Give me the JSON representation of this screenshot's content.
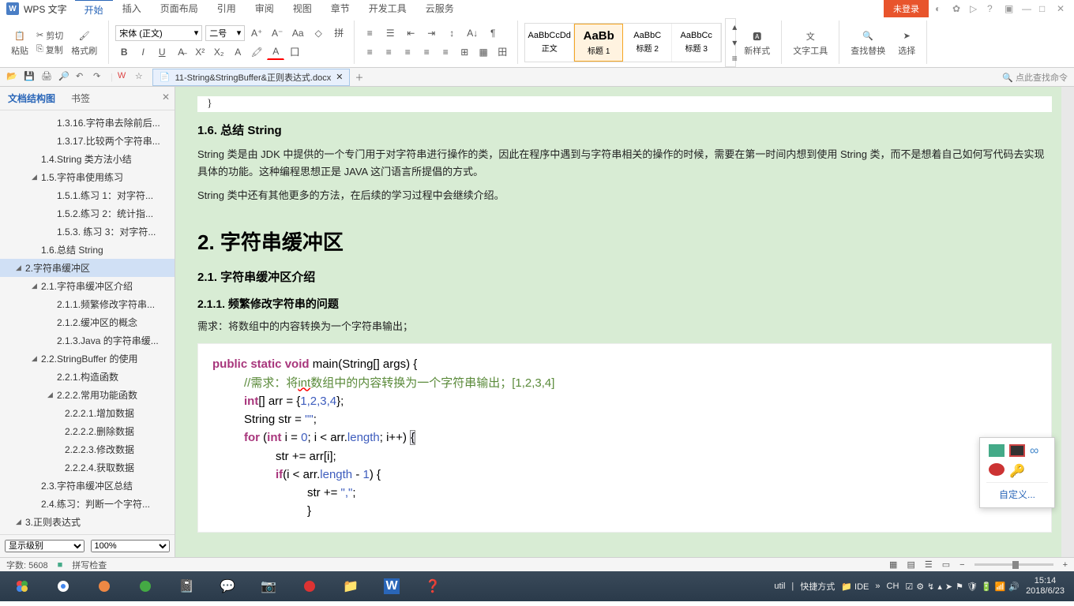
{
  "titlebar": {
    "app_prefix": "W",
    "app_name": "WPS 文字",
    "tabs": [
      "开始",
      "插入",
      "页面布局",
      "引用",
      "审阅",
      "视图",
      "章节",
      "开发工具",
      "云服务"
    ],
    "login_badge": "未登录"
  },
  "ribbon": {
    "paste": "粘贴",
    "cut": "剪切",
    "copy": "复制",
    "format_painter": "格式刷",
    "font_name": "宋体 (正文)",
    "font_size": "二号",
    "styles": [
      {
        "preview": "AaBbCcDd",
        "name": "正文"
      },
      {
        "preview": "AaBb",
        "name": "标题 1"
      },
      {
        "preview": "AaBbC",
        "name": "标题 2"
      },
      {
        "preview": "AaBbCc",
        "name": "标题 3"
      }
    ],
    "new_style": "新样式",
    "text_tools": "文字工具",
    "find_replace": "查找替换",
    "select": "选择"
  },
  "quick": {
    "doc_tab": "11-String&StringBuffer&正则表达式.docx",
    "search_hint": "点此查找命令"
  },
  "sidebar": {
    "tab1": "文档结构图",
    "tab2": "书签",
    "items": [
      {
        "l": 2,
        "t": "1.3.16.字符串去除前后..."
      },
      {
        "l": 2,
        "t": "1.3.17.比较两个字符串..."
      },
      {
        "l": 1,
        "t": "1.4.String 类方法小结"
      },
      {
        "l": 1,
        "t": "1.5.字符串使用练习",
        "exp": true
      },
      {
        "l": 2,
        "t": "1.5.1.练习 1：对字符..."
      },
      {
        "l": 2,
        "t": "1.5.2.练习 2：统计指..."
      },
      {
        "l": 2,
        "t": "1.5.3. 练习 3：对字符..."
      },
      {
        "l": 1,
        "t": "1.6.总结 String"
      },
      {
        "l": 0,
        "t": "2.字符串缓冲区",
        "sel": true,
        "exp": true
      },
      {
        "l": 1,
        "t": "2.1.字符串缓冲区介绍",
        "exp": true
      },
      {
        "l": 2,
        "t": "2.1.1.频繁修改字符串..."
      },
      {
        "l": 2,
        "t": "2.1.2.缓冲区的概念"
      },
      {
        "l": 2,
        "t": "2.1.3.Java 的字符串缓..."
      },
      {
        "l": 1,
        "t": "2.2.StringBuffer 的使用",
        "exp": true
      },
      {
        "l": 2,
        "t": "2.2.1.构造函数"
      },
      {
        "l": 2,
        "t": "2.2.2.常用功能函数",
        "exp": true
      },
      {
        "l": 3,
        "t": "2.2.2.1.增加数据"
      },
      {
        "l": 3,
        "t": "2.2.2.2.删除数据"
      },
      {
        "l": 3,
        "t": "2.2.2.3.修改数据"
      },
      {
        "l": 3,
        "t": "2.2.2.4.获取数据"
      },
      {
        "l": 1,
        "t": "2.3.字符串缓冲区总结"
      },
      {
        "l": 1,
        "t": "2.4.练习：判断一个字符..."
      },
      {
        "l": 0,
        "t": "3.正则表达式",
        "exp": true
      }
    ],
    "level_label": "显示级别",
    "zoom": "100%"
  },
  "document": {
    "h_1_6": "1.6. 总结 String",
    "p1": "String 类是由 JDK 中提供的一个专门用于对字符串进行操作的类，因此在程序中遇到与字符串相关的操作的时候，需要在第一时间内想到使用 String 类，而不是想着自己如何写代码去实现具体的功能。这种编程思想正是 JAVA 这门语言所提倡的方式。",
    "p2": "String 类中还有其他更多的方法，在后续的学习过程中会继续介绍。",
    "h_2": "2. 字符串缓冲区",
    "h_2_1": "2.1. 字符串缓冲区介绍",
    "h_2_1_1": "2.1.1. 频繁修改字符串的问题",
    "p3": "需求：将数组中的内容转换为一个字符串输出；",
    "code": {
      "l1a": "public",
      "l1b": "static",
      "l1c": "void",
      "l1d": "main(String[] args) {",
      "l2a": "//需求：将",
      "l2b": "int",
      "l2c": "数组中的内容转换为一个字符串输出；",
      "l2d": "[1,2,3,4]",
      "l3a": "int",
      "l3b": "[] arr = {",
      "l3c": "1,2,3,4",
      "l3d": "};",
      "l4a": "String str = ",
      "l4b": "\"\"",
      "l4c": ";",
      "l5a": "for",
      "l5b": " (",
      "l5c": "int",
      "l5d": " i = ",
      "l5e": "0",
      "l5f": "; i < arr.",
      "l5g": "length",
      "l5h": "; i++) ",
      "l5i": "{",
      "l6a": "str += arr[i];",
      "l7a": "if",
      "l7b": "(i < arr.",
      "l7c": "length",
      "l7d": " - ",
      "l7e": "1",
      "l7f": ") {",
      "l8a": "str += ",
      "l8b": "\",\"",
      "l8c": ";",
      "l9a": "}"
    }
  },
  "float_panel": {
    "custom": "自定义..."
  },
  "status": {
    "word_count": "字数: 5608",
    "spell": "拼写检查"
  },
  "taskbar": {
    "util": "util",
    "shortcut": "快捷方式",
    "ide": "IDE",
    "cn": "CH",
    "time": "15:14",
    "date": "2018/6/23"
  }
}
